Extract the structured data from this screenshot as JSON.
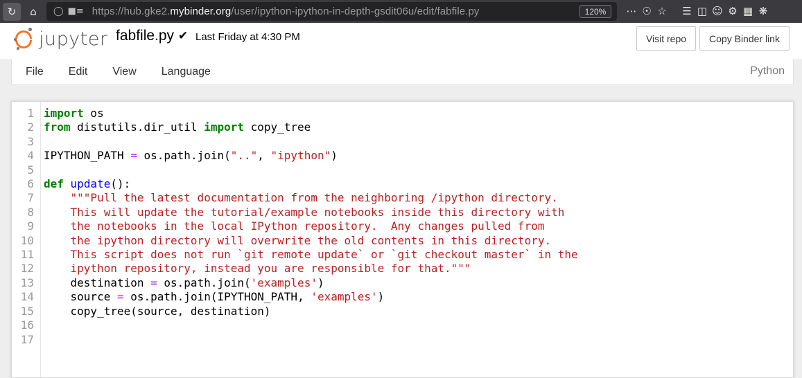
{
  "browser": {
    "url_prefix": "https://hub.gke2.",
    "url_host": "mybinder.org",
    "url_path": "/user/ipython-ipython-in-depth-gsdit06u/edit/fabfile.py",
    "zoom": "120%"
  },
  "header": {
    "logo_text": "jupyter",
    "filename": "fabfile.py",
    "last_saved": "Last Friday at 4:30 PM",
    "visit_repo": "Visit repo",
    "copy_binder": "Copy Binder link"
  },
  "menu": {
    "items": [
      "File",
      "Edit",
      "View",
      "Language"
    ],
    "kernel": "Python"
  },
  "editor": {
    "line_numbers": [
      "1",
      "2",
      "3",
      "4",
      "5",
      "6",
      "7",
      "8",
      "9",
      "10",
      "11",
      "12",
      "13",
      "14",
      "15",
      "16",
      "17"
    ],
    "lines": [
      "import os",
      "from distutils.dir_util import copy_tree",
      "",
      "IPYTHON_PATH = os.path.join(\"..\", \"ipython\")",
      "",
      "def update():",
      "    \"\"\"Pull the latest documentation from the neighboring /ipython directory.",
      "",
      "    This will update the tutorial/example notebooks inside this directory with",
      "    the notebooks in the local IPython repository.  Any changes pulled from",
      "    the ipython directory will overwrite the old contents in this directory.",
      "    This script does not run `git remote update` or `git checkout master` in the",
      "    ipython repository, instead you are responsible for that.\"\"\"",
      "    destination = os.path.join('examples')",
      "    source = os.path.join(IPYTHON_PATH, 'examples')",
      "    copy_tree(source, destination)",
      ""
    ]
  }
}
